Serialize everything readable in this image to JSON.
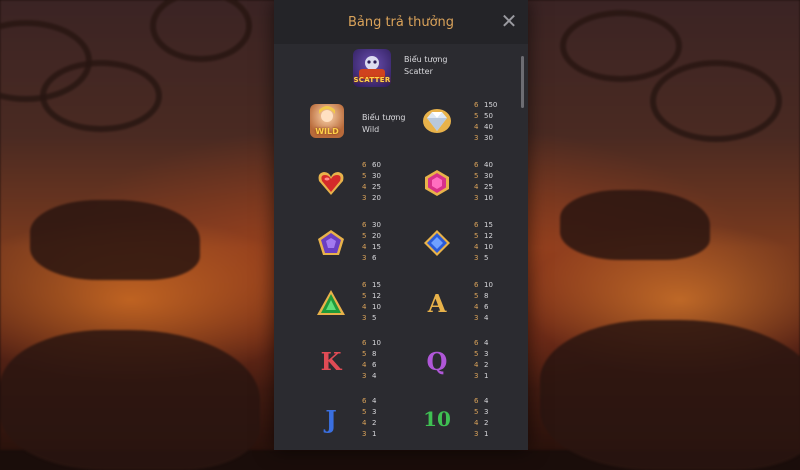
{
  "header": {
    "title": "Bảng trả thưởng"
  },
  "scatter": {
    "label": "SCATTER",
    "desc_line1": "Biểu tượng",
    "desc_line2": "Scatter"
  },
  "wild": {
    "label": "WILD",
    "desc_line1": "Biểu tượng",
    "desc_line2": "Wild"
  },
  "paytable": [
    {
      "left": {
        "symbol": "wild-icon",
        "pays": []
      },
      "right": {
        "symbol": "diamond-icon",
        "pays": [
          {
            "n": "6",
            "v": "150"
          },
          {
            "n": "5",
            "v": "50"
          },
          {
            "n": "4",
            "v": "40"
          },
          {
            "n": "3",
            "v": "30"
          }
        ]
      }
    },
    {
      "left": {
        "symbol": "red-heart-gem-icon",
        "pays": [
          {
            "n": "6",
            "v": "60"
          },
          {
            "n": "5",
            "v": "30"
          },
          {
            "n": "4",
            "v": "25"
          },
          {
            "n": "3",
            "v": "20"
          }
        ]
      },
      "right": {
        "symbol": "pink-hexagon-gem-icon",
        "pays": [
          {
            "n": "6",
            "v": "40"
          },
          {
            "n": "5",
            "v": "30"
          },
          {
            "n": "4",
            "v": "25"
          },
          {
            "n": "3",
            "v": "10"
          }
        ]
      }
    },
    {
      "left": {
        "symbol": "purple-pentagon-gem-icon",
        "pays": [
          {
            "n": "6",
            "v": "30"
          },
          {
            "n": "5",
            "v": "20"
          },
          {
            "n": "4",
            "v": "15"
          },
          {
            "n": "3",
            "v": "6"
          }
        ]
      },
      "right": {
        "symbol": "blue-rhombus-gem-icon",
        "pays": [
          {
            "n": "6",
            "v": "15"
          },
          {
            "n": "5",
            "v": "12"
          },
          {
            "n": "4",
            "v": "10"
          },
          {
            "n": "3",
            "v": "5"
          }
        ]
      }
    },
    {
      "left": {
        "symbol": "green-triangle-gem-icon",
        "pays": [
          {
            "n": "6",
            "v": "15"
          },
          {
            "n": "5",
            "v": "12"
          },
          {
            "n": "4",
            "v": "10"
          },
          {
            "n": "3",
            "v": "5"
          }
        ]
      },
      "right": {
        "symbol": "letter-a-icon",
        "letter": "A",
        "pays": [
          {
            "n": "6",
            "v": "10"
          },
          {
            "n": "5",
            "v": "8"
          },
          {
            "n": "4",
            "v": "6"
          },
          {
            "n": "3",
            "v": "4"
          }
        ]
      }
    },
    {
      "left": {
        "symbol": "letter-k-icon",
        "letter": "K",
        "pays": [
          {
            "n": "6",
            "v": "10"
          },
          {
            "n": "5",
            "v": "8"
          },
          {
            "n": "4",
            "v": "6"
          },
          {
            "n": "3",
            "v": "4"
          }
        ]
      },
      "right": {
        "symbol": "letter-q-icon",
        "letter": "Q",
        "pays": [
          {
            "n": "6",
            "v": "4"
          },
          {
            "n": "5",
            "v": "3"
          },
          {
            "n": "4",
            "v": "2"
          },
          {
            "n": "3",
            "v": "1"
          }
        ]
      }
    },
    {
      "left": {
        "symbol": "letter-j-icon",
        "letter": "J",
        "pays": [
          {
            "n": "6",
            "v": "4"
          },
          {
            "n": "5",
            "v": "3"
          },
          {
            "n": "4",
            "v": "2"
          },
          {
            "n": "3",
            "v": "1"
          }
        ]
      },
      "right": {
        "symbol": "number-10-icon",
        "letter": "10",
        "pays": [
          {
            "n": "6",
            "v": "4"
          },
          {
            "n": "5",
            "v": "3"
          },
          {
            "n": "4",
            "v": "2"
          },
          {
            "n": "3",
            "v": "1"
          }
        ]
      }
    }
  ],
  "colors": {
    "panel": "#2b2b30",
    "header": "#242428",
    "title": "#d9a25a",
    "pay_count": "#d9a25a",
    "pay_value": "#d8d8dc",
    "letter_a": "#e8b24a",
    "letter_k": "#e04b55",
    "letter_q": "#b057d8",
    "letter_j": "#3a6fe0",
    "number_10": "#3fbf52"
  }
}
